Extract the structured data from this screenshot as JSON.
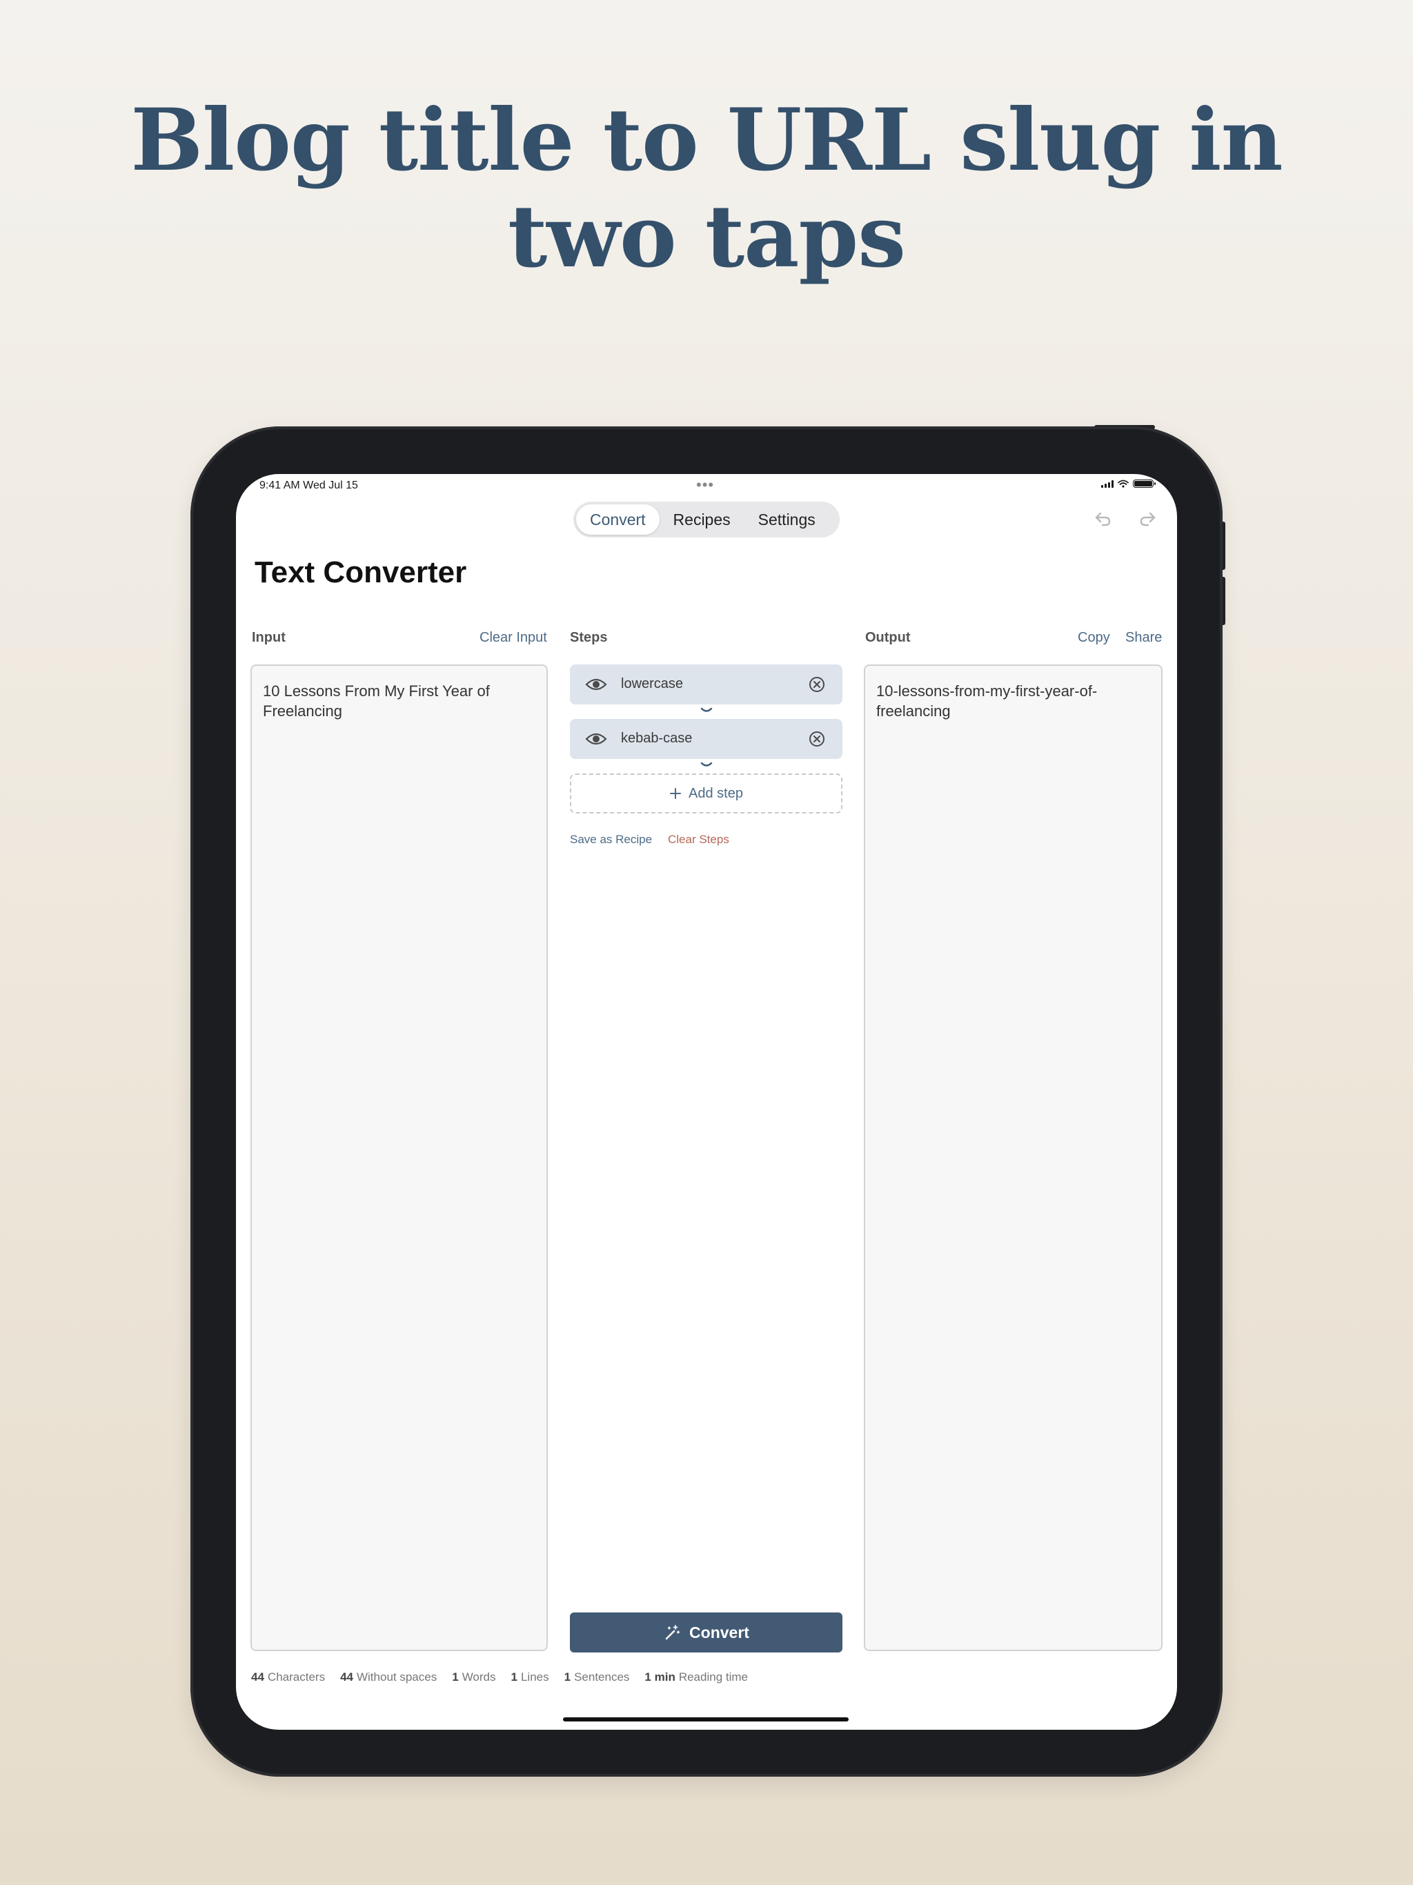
{
  "headline": "Blog title to URL slug in two taps",
  "status_bar": {
    "time": "9:41 AM  Wed Jul 15"
  },
  "nav": {
    "tabs": [
      {
        "label": "Convert",
        "active": true
      },
      {
        "label": "Recipes",
        "active": false
      },
      {
        "label": "Settings",
        "active": false
      }
    ]
  },
  "page_title": "Text Converter",
  "input": {
    "label": "Input",
    "clear_label": "Clear Input",
    "value": "10 Lessons From My First Year of Freelancing"
  },
  "steps": {
    "label": "Steps",
    "items": [
      {
        "label": "lowercase",
        "icon": "eye-icon"
      },
      {
        "label": "kebab-case",
        "icon": "eye-icon"
      }
    ],
    "add_label": "Add step",
    "save_recipe_label": "Save as Recipe",
    "clear_steps_label": "Clear Steps"
  },
  "convert_button": "Convert",
  "output": {
    "label": "Output",
    "copy_label": "Copy",
    "share_label": "Share",
    "value": "10-lessons-from-my-first-year-of-freelancing"
  },
  "stats": [
    {
      "value": "44",
      "label": "Characters"
    },
    {
      "value": "44",
      "label": "Without spaces"
    },
    {
      "value": "1",
      "label": "Words"
    },
    {
      "value": "1",
      "label": "Lines"
    },
    {
      "value": "1",
      "label": "Sentences"
    },
    {
      "value": "1 min",
      "label": "Reading time"
    }
  ],
  "colors": {
    "accent": "#4d6a87",
    "headline": "#34506b",
    "convert_button": "#425a74",
    "step_bg": "#dde4ec",
    "destructive": "#b5675a"
  }
}
